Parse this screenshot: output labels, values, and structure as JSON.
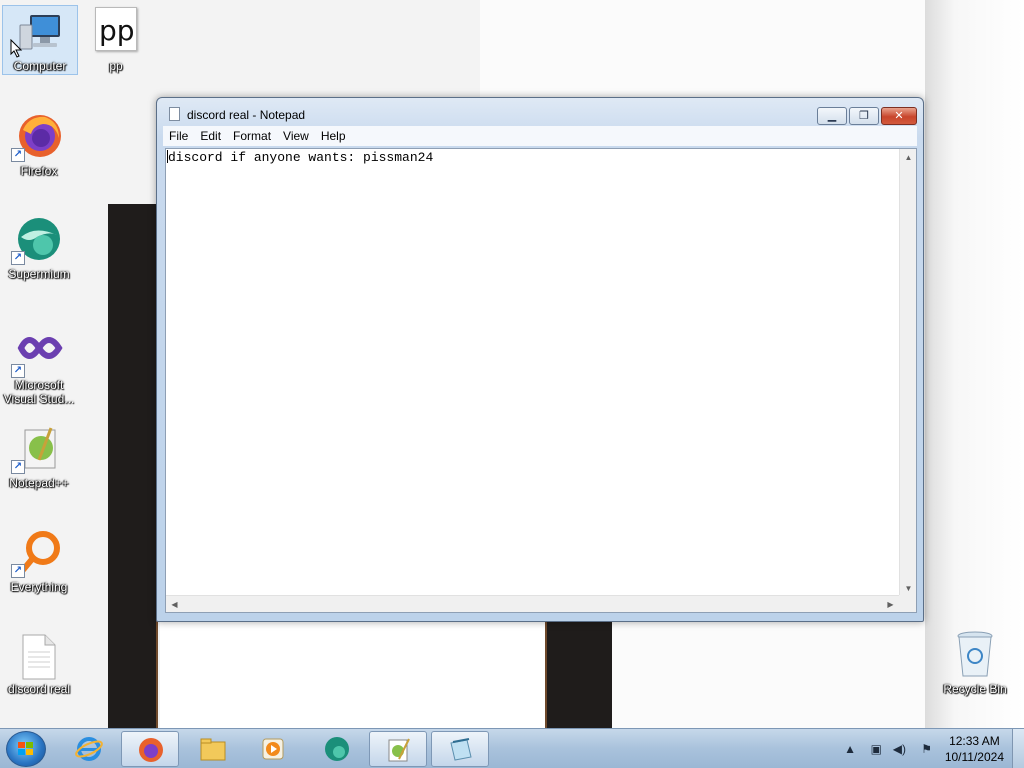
{
  "desktop": {
    "icons": [
      {
        "label": "Computer",
        "icon": "computer-icon"
      },
      {
        "label": "pp",
        "icon": "document-pp-icon"
      },
      {
        "label": "Firefox",
        "icon": "firefox-icon"
      },
      {
        "label": "Supermium",
        "icon": "supermium-icon"
      },
      {
        "label": "Microsoft\nVisual Stud...",
        "icon": "visual-studio-icon"
      },
      {
        "label": "Notepad++",
        "icon": "notepad-plus-plus-icon"
      },
      {
        "label": "Everything",
        "icon": "everything-search-icon"
      },
      {
        "label": "discord real",
        "icon": "text-file-icon"
      },
      {
        "label": "Recycle Bin",
        "icon": "recycle-bin-icon"
      }
    ],
    "pp_icon_text": "pp"
  },
  "window": {
    "title": "discord real - Notepad",
    "menu": [
      "File",
      "Edit",
      "Format",
      "View",
      "Help"
    ],
    "content": "discord if anyone wants: pissman24"
  },
  "taskbar": {
    "items": [
      "internet-explorer-icon",
      "firefox-icon",
      "file-explorer-icon",
      "media-player-icon",
      "supermium-icon",
      "notepad-plus-plus-icon",
      "notepad-icon"
    ],
    "clock": {
      "time": "12:33 AM",
      "date": "10/11/2024"
    }
  },
  "colors": {
    "taskbar": "#a9c2dc",
    "close_button": "#c8452c",
    "window_frame": "#c9daee"
  }
}
